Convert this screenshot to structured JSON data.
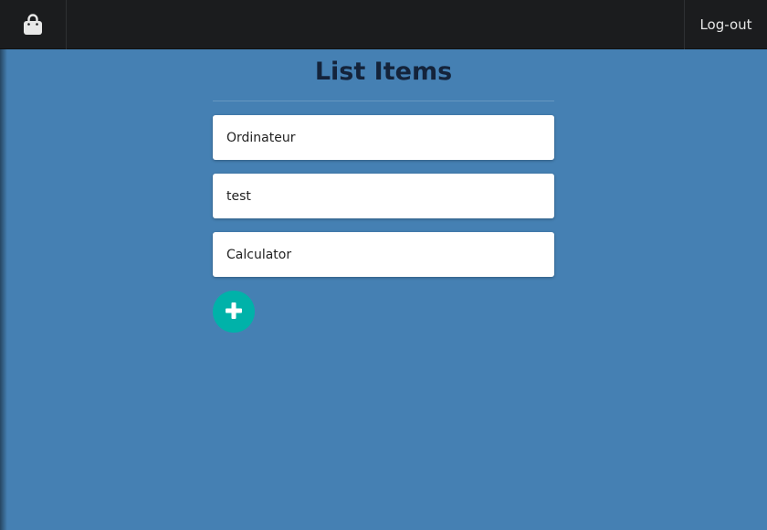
{
  "header": {
    "logo_icon": "shopping-bag-icon",
    "logout_label": "Log-out"
  },
  "main": {
    "title": "List Items",
    "items": [
      {
        "label": "Ordinateur"
      },
      {
        "label": "test"
      },
      {
        "label": "Calculator"
      }
    ],
    "add_icon": "plus-icon"
  },
  "colors": {
    "background": "#4580b3",
    "topbar": "#1b1c1e",
    "title": "#14233a",
    "add_button": "#00b2a9",
    "item_background": "#ffffff"
  }
}
